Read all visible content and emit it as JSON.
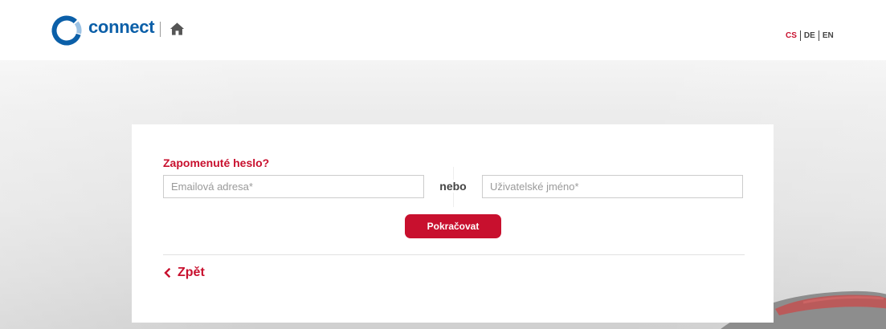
{
  "header": {
    "logo_text": "connect",
    "brand_color": "#0b5fa8",
    "languages": [
      {
        "code": "CS",
        "active": true
      },
      {
        "code": "DE",
        "active": false
      },
      {
        "code": "EN",
        "active": false
      }
    ],
    "home_icon": "home-icon"
  },
  "form": {
    "title": "Zapomenuté heslo?",
    "email_placeholder": "Emailová adresa*",
    "email_value": "",
    "or_label": "nebo",
    "username_placeholder": "Uživatelské jméno*",
    "username_value": "",
    "continue_label": "Pokračovat",
    "back_label": "Zpět",
    "back_icon": "chevron-left-icon"
  },
  "colors": {
    "accent": "#c8102e",
    "background": "#e6e6e6"
  }
}
